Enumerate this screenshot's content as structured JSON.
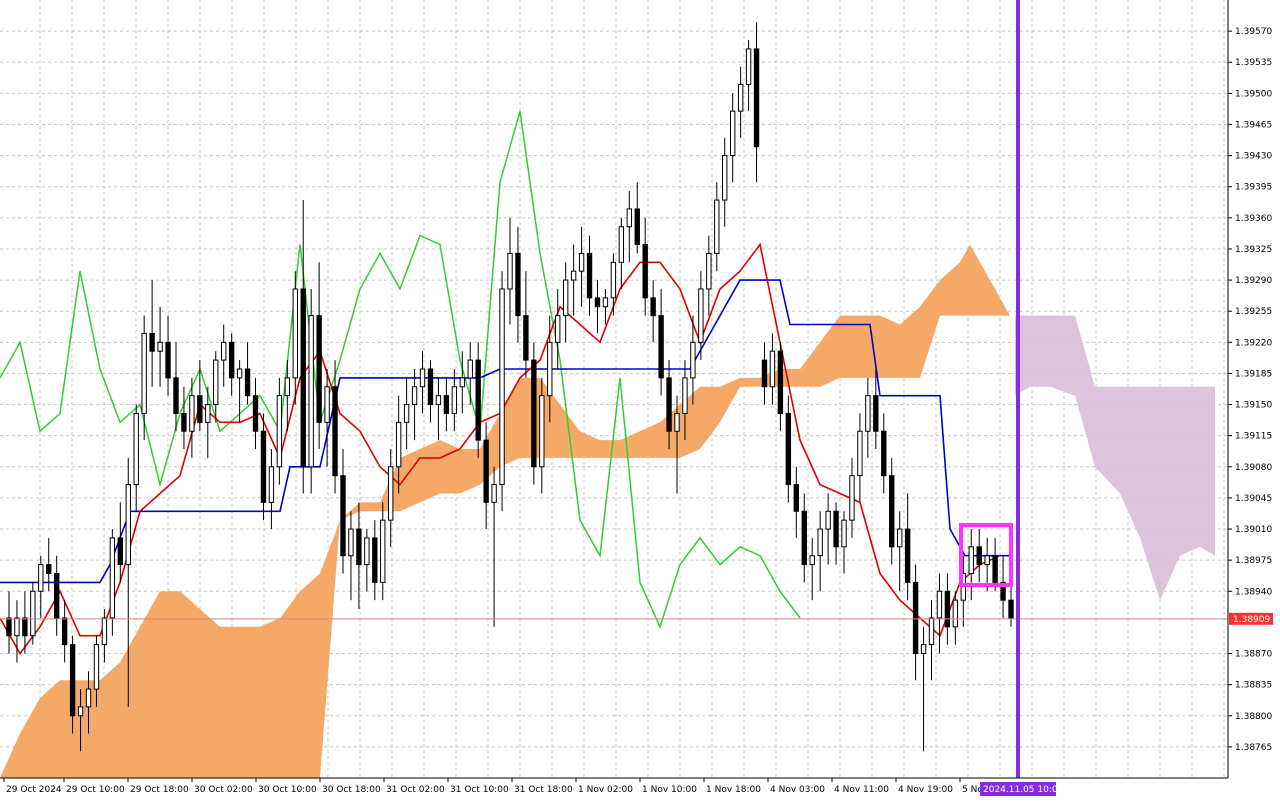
{
  "chart_data": {
    "type": "candlestick",
    "title": "",
    "xlabel": "",
    "ylabel": "",
    "ylim": [
      1.3873,
      1.39605
    ],
    "y_ticks": [
      "1.39570",
      "1.39535",
      "1.39500",
      "1.39465",
      "1.39430",
      "1.39395",
      "1.39360",
      "1.39325",
      "1.39290",
      "1.39255",
      "1.39220",
      "1.39185",
      "1.39150",
      "1.39115",
      "1.39080",
      "1.39045",
      "1.39010",
      "1.38975",
      "1.38940",
      "1.38870",
      "1.38835",
      "1.38800",
      "1.38765"
    ],
    "x_ticks": [
      "29 Oct 2024",
      "29 Oct 10:00",
      "29 Oct 18:00",
      "30 Oct 02:00",
      "30 Oct 10:00",
      "30 Oct 18:00",
      "31 Oct 02:00",
      "31 Oct 10:00",
      "31 Oct 18:00",
      "1 Nov 02:00",
      "1 Nov 10:00",
      "1 Nov 18:00",
      "4 Nov 03:00",
      "4 Nov 11:00",
      "4 Nov 19:00",
      "5 No"
    ],
    "grid": true,
    "current_price": "1.38909",
    "cursor_label": "2024.11.05 10:00",
    "candles": [
      [
        1.3891,
        1.3894,
        1.3887,
        1.3889
      ],
      [
        1.3889,
        1.3893,
        1.3886,
        1.3891
      ],
      [
        1.3891,
        1.3894,
        1.3887,
        1.3889
      ],
      [
        1.3889,
        1.3895,
        1.3888,
        1.3894
      ],
      [
        1.3894,
        1.3898,
        1.3891,
        1.3897
      ],
      [
        1.3897,
        1.39,
        1.3894,
        1.3896
      ],
      [
        1.3896,
        1.3898,
        1.3889,
        1.3891
      ],
      [
        1.3891,
        1.3893,
        1.3886,
        1.3888
      ],
      [
        1.3888,
        1.3889,
        1.3878,
        1.388
      ],
      [
        1.388,
        1.3883,
        1.3876,
        1.3881
      ],
      [
        1.3881,
        1.3885,
        1.3878,
        1.3883
      ],
      [
        1.3883,
        1.3889,
        1.3881,
        1.3888
      ],
      [
        1.3888,
        1.3892,
        1.3886,
        1.3891
      ],
      [
        1.3891,
        1.3901,
        1.3889,
        1.39
      ],
      [
        1.39,
        1.3904,
        1.3895,
        1.3897
      ],
      [
        1.3897,
        1.3909,
        1.3881,
        1.3906
      ],
      [
        1.3906,
        1.3915,
        1.3903,
        1.3914
      ],
      [
        1.3914,
        1.3925,
        1.3911,
        1.3923
      ],
      [
        1.3923,
        1.3929,
        1.3917,
        1.3921
      ],
      [
        1.3921,
        1.3926,
        1.3917,
        1.3922
      ],
      [
        1.3922,
        1.3925,
        1.3916,
        1.3918
      ],
      [
        1.3918,
        1.3922,
        1.3912,
        1.3914
      ],
      [
        1.3914,
        1.3917,
        1.391,
        1.3912
      ],
      [
        1.3912,
        1.3918,
        1.3909,
        1.3916
      ],
      [
        1.3916,
        1.392,
        1.3912,
        1.3913
      ],
      [
        1.3913,
        1.3917,
        1.3909,
        1.3915
      ],
      [
        1.3915,
        1.3921,
        1.3913,
        1.392
      ],
      [
        1.392,
        1.3924,
        1.3917,
        1.3922
      ],
      [
        1.3922,
        1.3923,
        1.3916,
        1.3918
      ],
      [
        1.3918,
        1.392,
        1.3913,
        1.3919
      ],
      [
        1.3919,
        1.3922,
        1.3915,
        1.3916
      ],
      [
        1.3916,
        1.3918,
        1.391,
        1.3912
      ],
      [
        1.3912,
        1.3914,
        1.3902,
        1.3904
      ],
      [
        1.3904,
        1.391,
        1.3901,
        1.3908
      ],
      [
        1.3908,
        1.3918,
        1.3906,
        1.3916
      ],
      [
        1.3916,
        1.392,
        1.3912,
        1.3918
      ],
      [
        1.3918,
        1.393,
        1.3915,
        1.3928
      ],
      [
        1.3928,
        1.3938,
        1.3905,
        1.3908
      ],
      [
        1.3908,
        1.3928,
        1.3905,
        1.3925
      ],
      [
        1.3925,
        1.3931,
        1.391,
        1.3913
      ],
      [
        1.3913,
        1.3919,
        1.3908,
        1.3917
      ],
      [
        1.3917,
        1.392,
        1.3905,
        1.3907
      ],
      [
        1.3907,
        1.391,
        1.3896,
        1.3898
      ],
      [
        1.3898,
        1.3903,
        1.3893,
        1.3901
      ],
      [
        1.3901,
        1.3904,
        1.3892,
        1.3897
      ],
      [
        1.3897,
        1.3901,
        1.3894,
        1.39
      ],
      [
        1.39,
        1.3902,
        1.3893,
        1.3895
      ],
      [
        1.3895,
        1.3904,
        1.3893,
        1.3902
      ],
      [
        1.3902,
        1.391,
        1.3899,
        1.3908
      ],
      [
        1.3908,
        1.3916,
        1.3905,
        1.3913
      ],
      [
        1.3913,
        1.3918,
        1.391,
        1.3915
      ],
      [
        1.3915,
        1.3919,
        1.3911,
        1.3917
      ],
      [
        1.3917,
        1.3921,
        1.3914,
        1.3919
      ],
      [
        1.3919,
        1.392,
        1.3913,
        1.3915
      ],
      [
        1.3915,
        1.3918,
        1.3911,
        1.3916
      ],
      [
        1.3916,
        1.3918,
        1.3912,
        1.3914
      ],
      [
        1.3914,
        1.3919,
        1.3912,
        1.3917
      ],
      [
        1.3917,
        1.3921,
        1.3914,
        1.3918
      ],
      [
        1.3918,
        1.3922,
        1.3915,
        1.392
      ],
      [
        1.392,
        1.3922,
        1.3909,
        1.3911
      ],
      [
        1.3911,
        1.3913,
        1.3901,
        1.3904
      ],
      [
        1.3904,
        1.3908,
        1.389,
        1.3906
      ],
      [
        1.3906,
        1.393,
        1.3903,
        1.3928
      ],
      [
        1.3928,
        1.3936,
        1.3924,
        1.3932
      ],
      [
        1.3932,
        1.3935,
        1.3922,
        1.3925
      ],
      [
        1.3925,
        1.393,
        1.3918,
        1.392
      ],
      [
        1.392,
        1.3922,
        1.3906,
        1.3908
      ],
      [
        1.3908,
        1.3918,
        1.3905,
        1.3916
      ],
      [
        1.3916,
        1.3925,
        1.3913,
        1.3922
      ],
      [
        1.3922,
        1.3928,
        1.3919,
        1.3925
      ],
      [
        1.3925,
        1.3931,
        1.3922,
        1.3929
      ],
      [
        1.3929,
        1.3933,
        1.3925,
        1.393
      ],
      [
        1.393,
        1.3935,
        1.3926,
        1.3932
      ],
      [
        1.3932,
        1.3934,
        1.3925,
        1.3927
      ],
      [
        1.3927,
        1.3929,
        1.3923,
        1.3926
      ],
      [
        1.3926,
        1.3928,
        1.3924,
        1.3927
      ],
      [
        1.3927,
        1.3932,
        1.3925,
        1.3931
      ],
      [
        1.3931,
        1.3936,
        1.3928,
        1.3935
      ],
      [
        1.3935,
        1.3939,
        1.3931,
        1.3937
      ],
      [
        1.3937,
        1.394,
        1.3932,
        1.3933
      ],
      [
        1.3933,
        1.3936,
        1.3925,
        1.3927
      ],
      [
        1.3927,
        1.3929,
        1.3922,
        1.3925
      ],
      [
        1.3925,
        1.3928,
        1.3916,
        1.3918
      ],
      [
        1.3918,
        1.392,
        1.391,
        1.3912
      ],
      [
        1.3912,
        1.3916,
        1.3905,
        1.3914
      ],
      [
        1.3914,
        1.392,
        1.3911,
        1.3918
      ],
      [
        1.3918,
        1.3925,
        1.3915,
        1.3922
      ],
      [
        1.3922,
        1.393,
        1.392,
        1.3928
      ],
      [
        1.3928,
        1.3934,
        1.3925,
        1.3932
      ],
      [
        1.3932,
        1.394,
        1.393,
        1.3938
      ],
      [
        1.3938,
        1.3945,
        1.3935,
        1.3943
      ],
      [
        1.3943,
        1.395,
        1.394,
        1.3948
      ],
      [
        1.3948,
        1.3953,
        1.3945,
        1.3951
      ],
      [
        1.3951,
        1.3956,
        1.3948,
        1.3955
      ],
      [
        1.3955,
        1.3958,
        1.394,
        1.3944
      ],
      [
        1.392,
        1.3922,
        1.3915,
        1.3917
      ],
      [
        1.3917,
        1.3923,
        1.3915,
        1.3921
      ],
      [
        1.3921,
        1.3922,
        1.3912,
        1.3914
      ],
      [
        1.3914,
        1.3916,
        1.3904,
        1.3906
      ],
      [
        1.3906,
        1.3908,
        1.39,
        1.3903
      ],
      [
        1.3903,
        1.3905,
        1.3895,
        1.3897
      ],
      [
        1.3897,
        1.39,
        1.3893,
        1.3898
      ],
      [
        1.3898,
        1.3903,
        1.3894,
        1.3901
      ],
      [
        1.3901,
        1.3905,
        1.3897,
        1.3903
      ],
      [
        1.3903,
        1.3904,
        1.3897,
        1.3899
      ],
      [
        1.3899,
        1.3903,
        1.3896,
        1.3902
      ],
      [
        1.3902,
        1.3909,
        1.39,
        1.3907
      ],
      [
        1.3907,
        1.3914,
        1.3904,
        1.3912
      ],
      [
        1.3912,
        1.3918,
        1.3909,
        1.3916
      ],
      [
        1.3916,
        1.3919,
        1.391,
        1.3912
      ],
      [
        1.3912,
        1.3914,
        1.3905,
        1.3907
      ],
      [
        1.3907,
        1.3909,
        1.3897,
        1.3899
      ],
      [
        1.3899,
        1.3903,
        1.3894,
        1.3901
      ],
      [
        1.3901,
        1.3905,
        1.3893,
        1.3895
      ],
      [
        1.3895,
        1.3897,
        1.3884,
        1.3887
      ],
      [
        1.3887,
        1.389,
        1.3876,
        1.3888
      ],
      [
        1.3888,
        1.3893,
        1.3884,
        1.3891
      ],
      [
        1.3891,
        1.3896,
        1.3887,
        1.3894
      ],
      [
        1.3894,
        1.3896,
        1.3888,
        1.389
      ],
      [
        1.389,
        1.3894,
        1.3888,
        1.3893
      ],
      [
        1.3893,
        1.3898,
        1.389,
        1.3896
      ],
      [
        1.3896,
        1.3901,
        1.3893,
        1.3899
      ],
      [
        1.3899,
        1.3901,
        1.3895,
        1.3897
      ],
      [
        1.3897,
        1.39,
        1.3894,
        1.3898
      ],
      [
        1.3898,
        1.39,
        1.3894,
        1.3895
      ],
      [
        1.3895,
        1.3898,
        1.3891,
        1.3893
      ],
      [
        1.3893,
        1.3896,
        1.389,
        1.3891
      ]
    ],
    "cloud_edges": {
      "x": [
        0,
        20,
        40,
        60,
        80,
        100,
        120,
        140,
        160,
        180,
        200,
        220,
        240,
        260,
        280,
        300,
        320,
        340,
        360,
        380,
        400,
        420,
        440,
        460,
        480,
        500,
        520,
        540,
        560,
        580,
        600,
        620,
        640,
        660,
        680,
        700,
        720,
        740,
        760,
        780,
        800,
        820,
        840,
        860,
        880,
        900,
        920,
        940,
        960,
        970,
        990,
        1010
      ],
      "a": [
        1.3873,
        1.3878,
        1.3882,
        1.3884,
        1.3884,
        1.3884,
        1.3886,
        1.389,
        1.3894,
        1.3894,
        1.3892,
        1.389,
        1.389,
        1.389,
        1.3891,
        1.3894,
        1.3896,
        1.3902,
        1.3904,
        1.3904,
        1.3909,
        1.391,
        1.3911,
        1.391,
        1.391,
        1.3914,
        1.3918,
        1.3918,
        1.3915,
        1.3912,
        1.3911,
        1.3911,
        1.3912,
        1.3913,
        1.3915,
        1.3917,
        1.3917,
        1.3918,
        1.3918,
        1.3919,
        1.3919,
        1.3922,
        1.3925,
        1.3925,
        1.3925,
        1.3924,
        1.3926,
        1.3929,
        1.3931,
        1.3933,
        1.3929,
        1.3925
      ],
      "b": [
        1.3873,
        1.3873,
        1.3873,
        1.3873,
        1.3873,
        1.3873,
        1.3873,
        1.3873,
        1.3873,
        1.3873,
        1.3873,
        1.3873,
        1.3873,
        1.3873,
        1.3873,
        1.3873,
        1.3873,
        1.3902,
        1.3903,
        1.3903,
        1.3903,
        1.3904,
        1.3905,
        1.3905,
        1.3906,
        1.3908,
        1.3909,
        1.3909,
        1.3909,
        1.3909,
        1.3909,
        1.3909,
        1.3909,
        1.3909,
        1.3909,
        1.391,
        1.3913,
        1.3917,
        1.3917,
        1.3917,
        1.3917,
        1.3917,
        1.3918,
        1.3918,
        1.3918,
        1.3918,
        1.3918,
        1.3925,
        1.3925,
        1.3925,
        1.3925,
        1.3925
      ]
    },
    "future_cloud": {
      "x": [
        1015,
        1030,
        1050,
        1075,
        1095,
        1120,
        1140,
        1160,
        1180,
        1200,
        1215
      ],
      "top": [
        1.3925,
        1.3925,
        1.3925,
        1.3925,
        1.3917,
        1.3917,
        1.3917,
        1.3917,
        1.3917,
        1.3917,
        1.3917
      ],
      "bottom": [
        1.3916,
        1.3917,
        1.3917,
        1.3916,
        1.3908,
        1.3905,
        1.39,
        1.3893,
        1.3898,
        1.3899,
        1.3898
      ]
    },
    "kijun": {
      "x": [
        0,
        100,
        110,
        130,
        280,
        290,
        320,
        340,
        480,
        500,
        690,
        740,
        780,
        790,
        870,
        880,
        940,
        950,
        965,
        1010
      ],
      "y": [
        1.3895,
        1.3895,
        1.3897,
        1.3903,
        1.3903,
        1.3908,
        1.3908,
        1.3918,
        1.3918,
        1.3919,
        1.3919,
        1.3929,
        1.3929,
        1.3924,
        1.3924,
        1.3916,
        1.3916,
        1.3901,
        1.3898,
        1.3898
      ]
    },
    "tenkan": {
      "x": [
        0,
        20,
        40,
        60,
        80,
        100,
        120,
        140,
        160,
        180,
        200,
        220,
        240,
        260,
        280,
        300,
        320,
        340,
        360,
        380,
        400,
        420,
        440,
        460,
        480,
        500,
        520,
        540,
        560,
        580,
        600,
        620,
        640,
        660,
        680,
        700,
        720,
        740,
        760,
        780,
        800,
        820,
        840,
        860,
        880,
        900,
        920,
        940,
        960,
        980,
        1000
      ],
      "y": [
        1.3891,
        1.3887,
        1.389,
        1.3894,
        1.3889,
        1.3889,
        1.3895,
        1.3903,
        1.3905,
        1.3907,
        1.3915,
        1.3913,
        1.3913,
        1.3914,
        1.3909,
        1.3918,
        1.3921,
        1.3914,
        1.3912,
        1.3908,
        1.3906,
        1.3909,
        1.3909,
        1.391,
        1.3913,
        1.3914,
        1.3918,
        1.392,
        1.3926,
        1.3924,
        1.3922,
        1.3928,
        1.3931,
        1.3931,
        1.3928,
        1.3922,
        1.3928,
        1.393,
        1.3933,
        1.3922,
        1.3911,
        1.3906,
        1.3905,
        1.3904,
        1.3896,
        1.3893,
        1.3891,
        1.3889,
        1.3895,
        1.3897,
        1.3898
      ]
    },
    "chikou": {
      "x": [
        0,
        20,
        40,
        60,
        80,
        100,
        120,
        140,
        160,
        180,
        200,
        220,
        240,
        260,
        280,
        300,
        320,
        340,
        360,
        380,
        400,
        420,
        440,
        460,
        480,
        500,
        520,
        540,
        560,
        580,
        600,
        620,
        640,
        660,
        680,
        700,
        720,
        740,
        760,
        780,
        800
      ],
      "y": [
        1.3918,
        1.3922,
        1.3912,
        1.3914,
        1.393,
        1.3919,
        1.3913,
        1.3915,
        1.3906,
        1.3914,
        1.3919,
        1.3912,
        1.3914,
        1.3916,
        1.3912,
        1.3933,
        1.3913,
        1.392,
        1.3928,
        1.3932,
        1.3928,
        1.3934,
        1.3933,
        1.392,
        1.3912,
        1.394,
        1.3948,
        1.3932,
        1.392,
        1.3902,
        1.3898,
        1.3918,
        1.3895,
        1.389,
        1.3897,
        1.39,
        1.3897,
        1.3899,
        1.3898,
        1.3894,
        1.3891
      ]
    }
  }
}
